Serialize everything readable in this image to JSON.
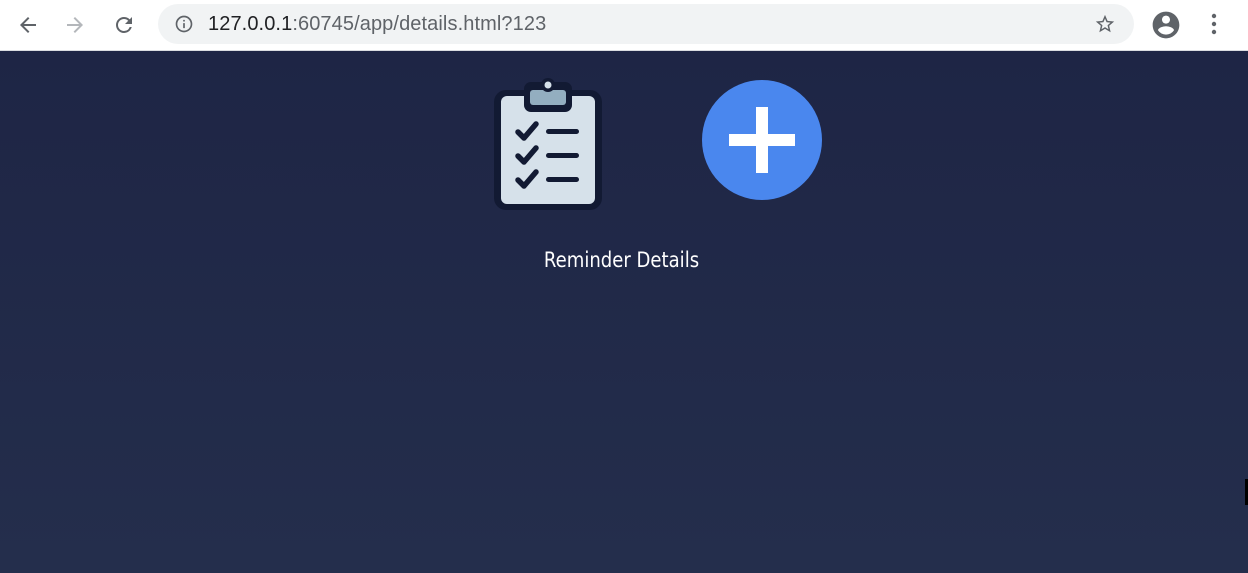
{
  "browser": {
    "url_host": "127.0.0.1",
    "url_rest": ":60745/app/details.html?123",
    "icons": {
      "back": "arrow-left-icon",
      "forward": "arrow-right-icon",
      "reload": "reload-icon",
      "site_info": "info-icon",
      "bookmark": "star-icon",
      "profile": "account-circle-icon",
      "menu": "more-vertical-icon"
    }
  },
  "page": {
    "title": "Reminder Details",
    "icons": {
      "clipboard": "clipboard-checklist-icon",
      "add": "plus-circle-icon"
    },
    "colors": {
      "background_top": "#1e2545",
      "background_bottom": "#242e4c",
      "add_button": "#4a87ee"
    }
  }
}
